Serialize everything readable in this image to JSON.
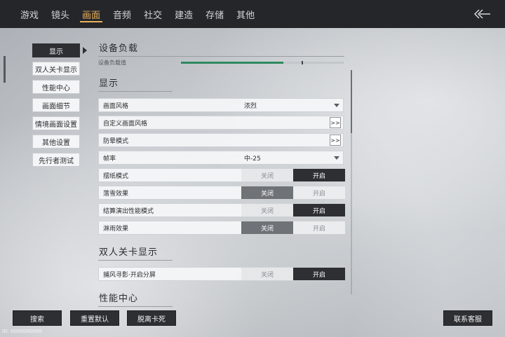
{
  "topbar": {
    "tabs": [
      {
        "label": "游戏"
      },
      {
        "label": "镜头"
      },
      {
        "label": "画面",
        "active": true
      },
      {
        "label": "音频"
      },
      {
        "label": "社交"
      },
      {
        "label": "建造"
      },
      {
        "label": "存储"
      },
      {
        "label": "其他"
      }
    ],
    "back_icon": "double-chevron-left-arrow-icon"
  },
  "leftnav": {
    "items": [
      {
        "label": "显示",
        "active": true
      },
      {
        "label": "双人关卡显示"
      },
      {
        "label": "性能中心"
      },
      {
        "label": "画面细节"
      },
      {
        "label": "情境画面设置"
      },
      {
        "label": "其他设置"
      },
      {
        "label": "先行者测试"
      }
    ]
  },
  "device_load": {
    "title": "设备负载",
    "value_label": "设备负载值",
    "fill_fraction": 0.63,
    "marker_fraction": 0.74,
    "fill_color": "#2f8a5f"
  },
  "display": {
    "title": "显示",
    "rows": {
      "style": {
        "label": "画面风格",
        "value": "浓烈"
      },
      "custom_style": {
        "label": "自定义画面风格",
        "button": ">>"
      },
      "motion_sickness": {
        "label": "防晕模式",
        "button": ">>"
      },
      "framerate": {
        "label": "帧率",
        "value": "中-25"
      },
      "paper_mode": {
        "label": "摆纸模式",
        "off": "关闭",
        "on": "开启",
        "state": "on"
      },
      "snow_effect": {
        "label": "落雪效果",
        "off": "关闭",
        "on": "开启",
        "state": "off"
      },
      "settlement_perf": {
        "label": "结算演出性能模式",
        "off": "关闭",
        "on": "开启",
        "state": "on"
      },
      "rain_effect": {
        "label": "淋雨效果",
        "off": "关闭",
        "on": "开启",
        "state": "off"
      }
    }
  },
  "coop": {
    "title": "双人关卡显示",
    "rows": {
      "splitscreen": {
        "label": "捕风寻影·开启分屏",
        "off": "关闭",
        "on": "开启",
        "state": "on"
      }
    }
  },
  "perf": {
    "title": "性能中心"
  },
  "bottom": {
    "search": "搜索",
    "reset": "重置默认",
    "unstuck": "脱离卡死",
    "support": "联系客服"
  },
  "id_text": "ID: 0000000000"
}
